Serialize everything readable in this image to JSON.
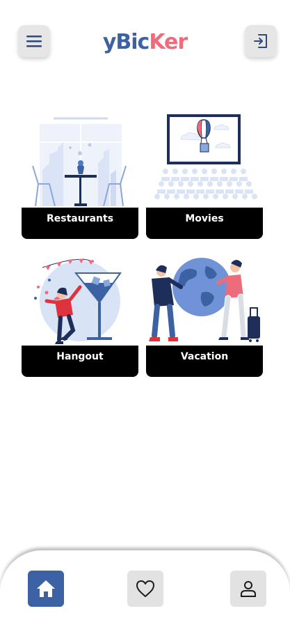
{
  "app": {
    "logo_part1": "yBic",
    "logo_part2": "Ker"
  },
  "header": {
    "menu_icon": "hamburger-menu-icon",
    "logout_icon": "sign-out-icon"
  },
  "categories": [
    {
      "label": "Restaurants",
      "illustration": "restaurant-table-illustration"
    },
    {
      "label": "Movies",
      "illustration": "cinema-screen-illustration"
    },
    {
      "label": "Hangout",
      "illustration": "party-cocktail-illustration"
    },
    {
      "label": "Vacation",
      "illustration": "travel-globe-illustration"
    }
  ],
  "bottom_nav": {
    "active": "home",
    "items": [
      {
        "id": "home",
        "icon": "home-icon"
      },
      {
        "id": "favorites",
        "icon": "heart-icon"
      },
      {
        "id": "profile",
        "icon": "user-icon"
      }
    ]
  },
  "colors": {
    "brand_blue": "#3d62a4",
    "brand_pink": "#ec6c7c",
    "card_label_bg": "#000000",
    "button_gray": "#e6e6e6"
  }
}
